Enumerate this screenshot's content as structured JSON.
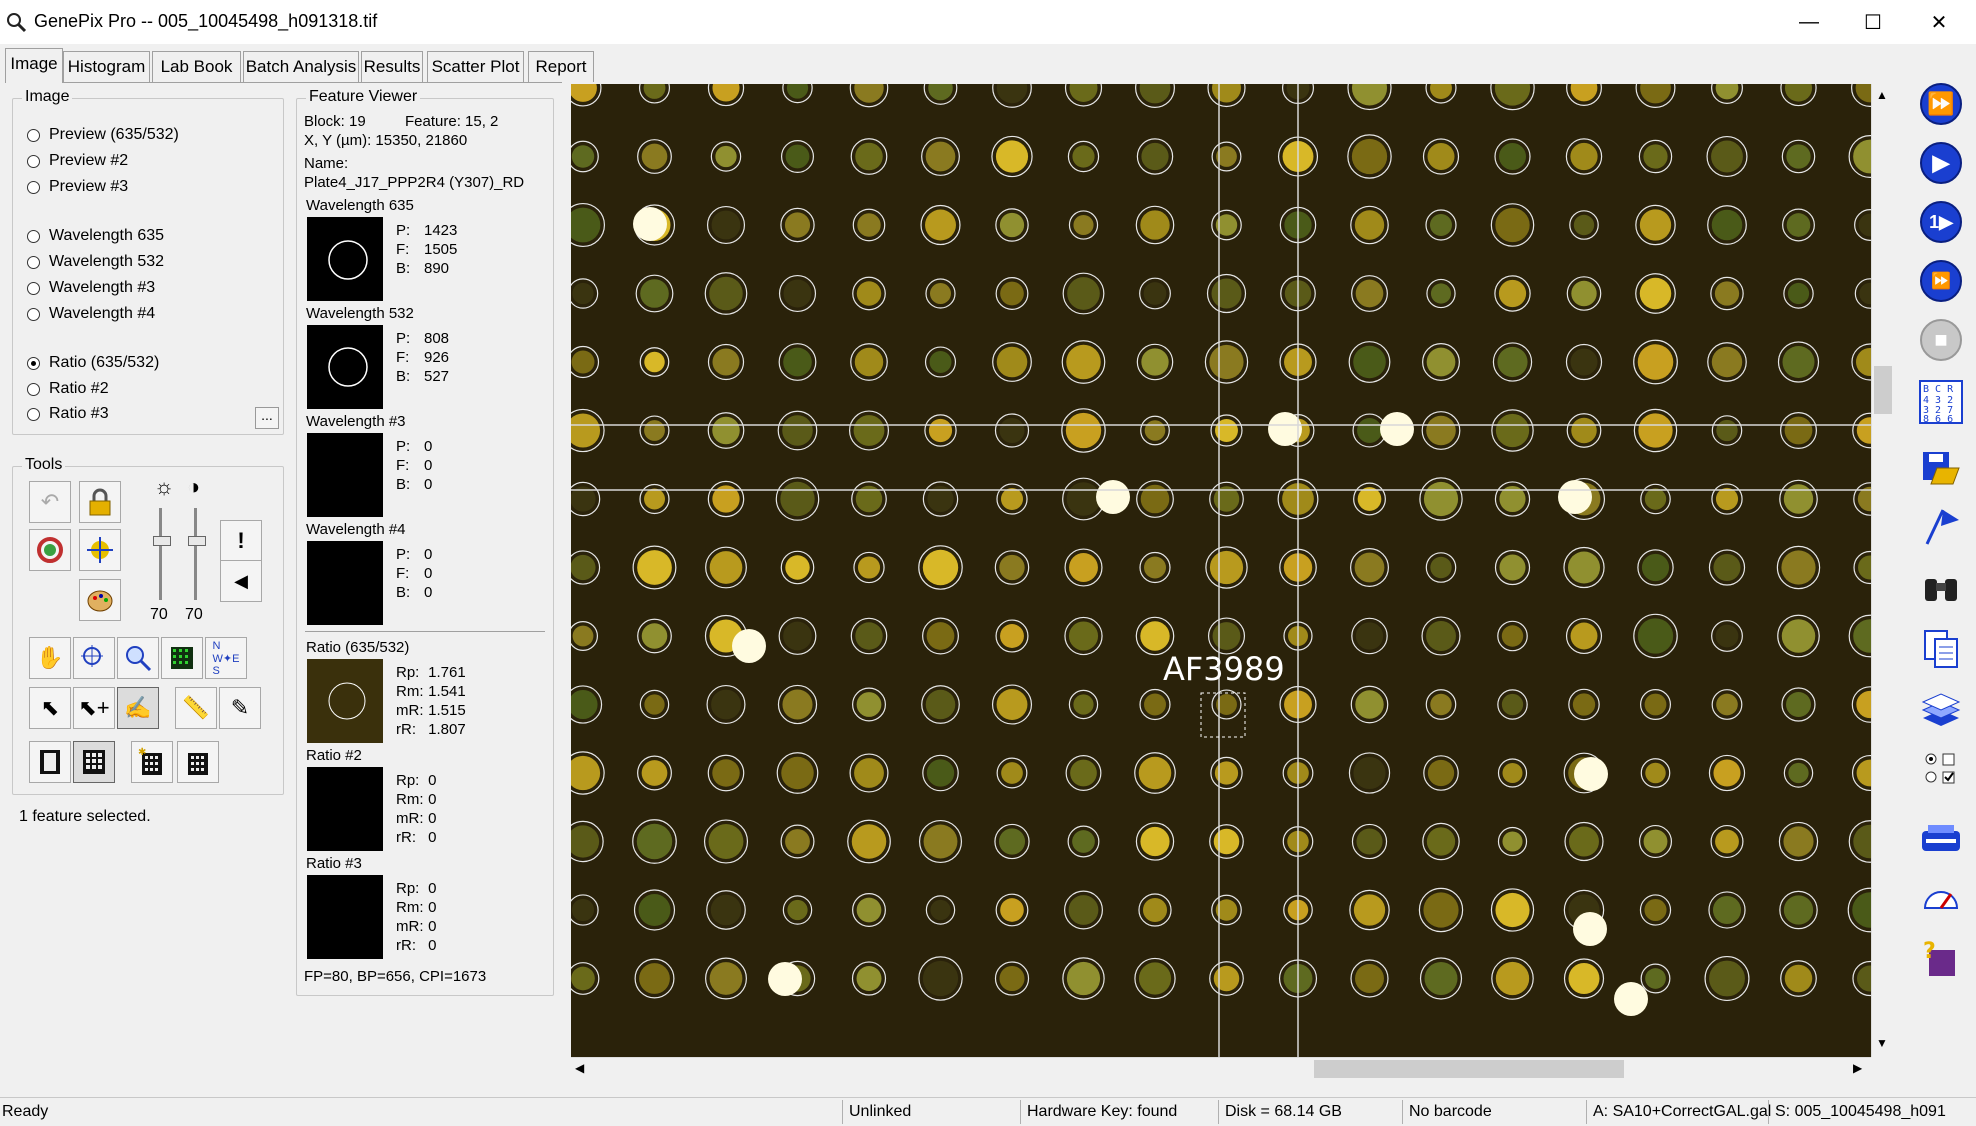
{
  "window": {
    "title": "GenePix Pro -- 005_10045498_h091318.tif",
    "controls": {
      "minimize": "—",
      "maximize": "☐",
      "close": "✕"
    }
  },
  "tabs": [
    "Image",
    "Histogram",
    "Lab Book",
    "Batch Analysis",
    "Results",
    "Scatter Plot",
    "Report"
  ],
  "active_tab": "Image",
  "image_group": {
    "legend": "Image",
    "options": [
      "Preview (635/532)",
      "Preview #2",
      "Preview #3",
      "Wavelength 635",
      "Wavelength 532",
      "Wavelength #3",
      "Wavelength #4",
      "Ratio (635/532)",
      "Ratio #2",
      "Ratio #3"
    ],
    "selected": "Ratio (635/532)",
    "more_button": "..."
  },
  "tools_group": {
    "legend": "Tools",
    "brightness_value": "70",
    "contrast_value": "70",
    "brightness_level": 0.7,
    "contrast_level": 0.7
  },
  "status_message": "1 feature selected.",
  "feature_viewer": {
    "legend": "Feature Viewer",
    "block_label": "Block: 19",
    "feature_label": "Feature:  15, 2",
    "xy_label": "X, Y (µm): 15350, 21860",
    "name_label": "Name:",
    "name_value": "Plate4_J17_PPP2R4 (Y307)_RD",
    "wavelengths": [
      {
        "title": "Wavelength 635",
        "P": "1423",
        "F": "1505",
        "B": "890"
      },
      {
        "title": "Wavelength 532",
        "P": "808",
        "F": "926",
        "B": "527"
      },
      {
        "title": "Wavelength #3",
        "P": "0",
        "F": "0",
        "B": "0"
      },
      {
        "title": "Wavelength #4",
        "P": "0",
        "F": "0",
        "B": "0"
      }
    ],
    "ratios": [
      {
        "title": "Ratio (635/532)",
        "Rp": "1.761",
        "Rm": "1.541",
        "mR": "1.515",
        "rR": "1.807"
      },
      {
        "title": "Ratio #2",
        "Rp": "0",
        "Rm": "0",
        "mR": "0",
        "rR": "0"
      },
      {
        "title": "Ratio #3",
        "Rp": "0",
        "Rm": "0",
        "mR": "0",
        "rR": "0"
      }
    ],
    "footer": "FP=80, BP=656, CPI=1673"
  },
  "image_view": {
    "feature_label": "AF3989",
    "background_color": "#2a220a"
  },
  "statusbar": {
    "ready": "Ready",
    "link": "Unlinked",
    "hardware": "Hardware Key: found",
    "disk": "Disk = 68.14 GB",
    "barcode": "No barcode",
    "gal": "A: SA10+CorrectGAL.gal",
    "settings": "S: 005_10045498_h091"
  },
  "right_toolbar": {
    "icons": [
      "fast-forward-icon",
      "play-icon",
      "step-icon",
      "repeat-scan-icon",
      "stop-icon",
      "block-layout-icon",
      "save-open-icon",
      "flag-icon",
      "binoculars-icon",
      "copy-icon",
      "layers-icon",
      "options-icon",
      "scanner-icon",
      "gauge-icon",
      "help-book-icon"
    ],
    "block_grid_label": "B C R\n4 3 2\n3 2 7\n8 6 6"
  }
}
